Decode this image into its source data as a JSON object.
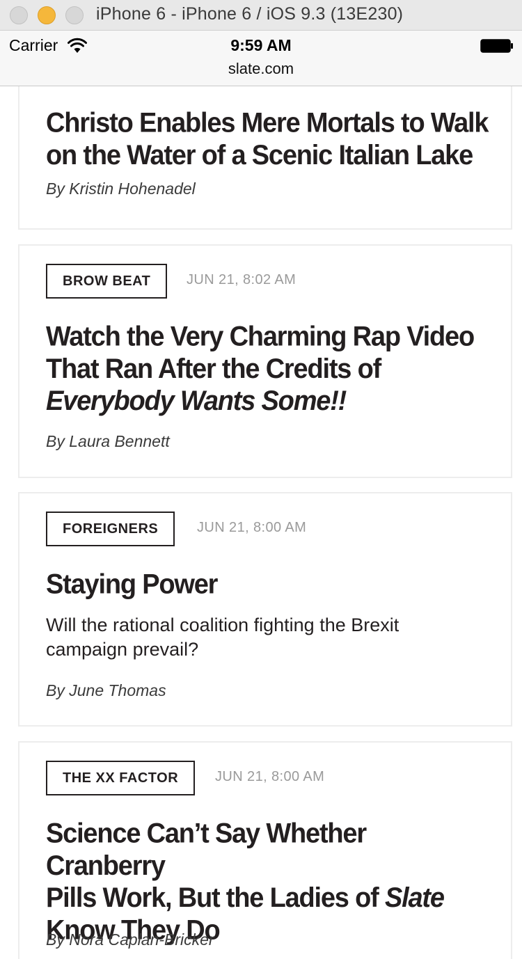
{
  "window": {
    "title": "iPhone 6 - iPhone 6 / iOS 9.3 (13E230)"
  },
  "status_bar": {
    "carrier": "Carrier",
    "time": "9:59 AM",
    "wifi_icon": "wifi-icon",
    "battery_icon": "battery-icon"
  },
  "browser": {
    "url": "slate.com"
  },
  "articles": [
    {
      "headline": "Christo Enables Mere Mortals to Walk on the Water of a Scenic Italian Lake",
      "byline": "By Kristin Hohenadel"
    },
    {
      "tag": "BROW BEAT",
      "date": "JUN 21, 8:02 AM",
      "headline_line1": "Watch the Very Charming Rap Video",
      "headline_line2": "That Ran After the Credits of",
      "headline_italic": "Everybody Wants Some!!",
      "byline": "By Laura Bennett"
    },
    {
      "tag": "FOREIGNERS",
      "date": "JUN 21, 8:00 AM",
      "headline": "Staying Power",
      "dek": "Will the rational coalition fighting the Brexit campaign prevail?",
      "byline": "By June Thomas"
    },
    {
      "tag": "THE XX FACTOR",
      "date": "JUN 21, 8:00 AM",
      "headline_line1": "Science Can’t Say Whether Cranberry",
      "headline_line2_pre": "Pills Work, But the Ladies of ",
      "headline_line2_italic": "Slate",
      "headline_line3": "Know They Do",
      "byline": "By Nora Caplan-Bricker"
    }
  ]
}
